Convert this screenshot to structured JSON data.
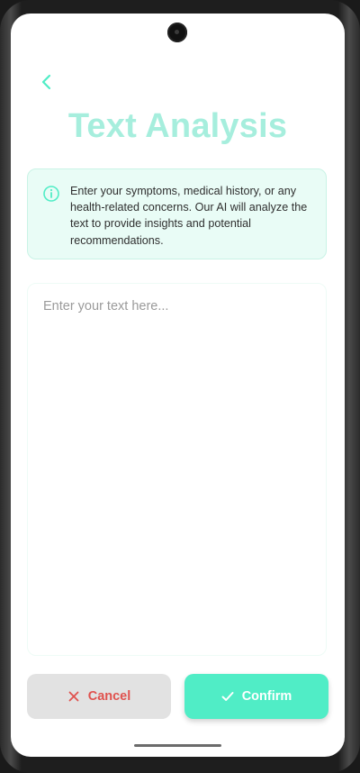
{
  "header": {
    "title": "Text Analysis"
  },
  "info": {
    "text": "Enter your symptoms, medical history, or any health-related concerns. Our AI will analyze the text to provide insights and potential recommendations."
  },
  "input": {
    "value": "",
    "placeholder": "Enter your text here..."
  },
  "actions": {
    "cancel_label": "Cancel",
    "confirm_label": "Confirm"
  },
  "icons": {
    "back": "chevron-left-icon",
    "info": "info-circle-icon",
    "cancel": "close-icon",
    "confirm": "check-icon"
  },
  "colors": {
    "accent": "#50edc6",
    "title": "#a6eedd",
    "info_bg": "#e9fcf6",
    "cancel_text": "#e0524e",
    "cancel_bg": "#e2e2e2"
  }
}
